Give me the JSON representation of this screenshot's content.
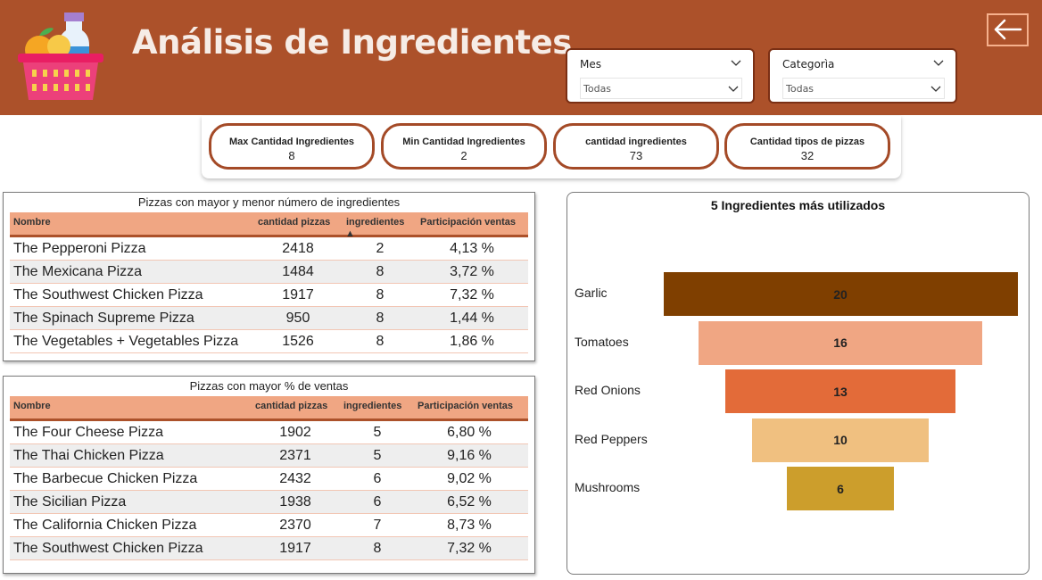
{
  "header": {
    "title": "Análisis de Ingredientes",
    "background": "#ac512a"
  },
  "slicers": [
    {
      "label": "Mes",
      "value": "Todas"
    },
    {
      "label": "Categorìa",
      "value": "Todas"
    }
  ],
  "kpis": [
    {
      "title": "Max Cantidad Ingredientes",
      "value": "8"
    },
    {
      "title": "Min Cantidad Ingredientes",
      "value": "2"
    },
    {
      "title": "cantidad ingredientes",
      "value": "73"
    },
    {
      "title": "Cantidad tipos de pizzas",
      "value": "32"
    }
  ],
  "table1": {
    "title": "Pizzas con mayor y menor número de ingredientes",
    "columns": [
      "Nombre",
      "cantidad pizzas",
      "ingredientes",
      "Participación ventas"
    ],
    "rows": [
      [
        "The Pepperoni Pizza",
        "2418",
        "2",
        "4,13 %"
      ],
      [
        "The Mexicana Pizza",
        "1484",
        "8",
        "3,72 %"
      ],
      [
        "The Southwest Chicken Pizza",
        "1917",
        "8",
        "7,32 %"
      ],
      [
        "The Spinach Supreme Pizza",
        "950",
        "8",
        "1,44 %"
      ],
      [
        "The Vegetables + Vegetables Pizza",
        "1526",
        "8",
        "1,86 %"
      ]
    ]
  },
  "table2": {
    "title": "Pizzas con mayor % de ventas",
    "columns": [
      "Nombre",
      "cantidad pizzas",
      "ingredientes",
      "Participación ventas"
    ],
    "rows": [
      [
        "The Four Cheese Pizza",
        "1902",
        "5",
        "6,80 %"
      ],
      [
        "The Thai Chicken Pizza",
        "2371",
        "5",
        "9,16 %"
      ],
      [
        "The Barbecue Chicken Pizza",
        "2432",
        "6",
        "9,02 %"
      ],
      [
        "The Sicilian Pizza",
        "1938",
        "6",
        "6,52 %"
      ],
      [
        "The California Chicken Pizza",
        "2370",
        "7",
        "8,73 %"
      ],
      [
        "The Southwest Chicken Pizza",
        "1917",
        "8",
        "7,32 %"
      ]
    ]
  },
  "chart_data": {
    "type": "bar",
    "subtype": "funnel",
    "title": "5 Ingredientes más utilizados",
    "categories": [
      "Garlic",
      "Tomatoes",
      "Red Onions",
      "Red Peppers",
      "Mushrooms"
    ],
    "values": [
      20,
      16,
      13,
      10,
      6
    ],
    "colors": [
      "#7f3f00",
      "#f0a683",
      "#e36b39",
      "#f0c080",
      "#cc9e2c"
    ],
    "max": 20
  }
}
